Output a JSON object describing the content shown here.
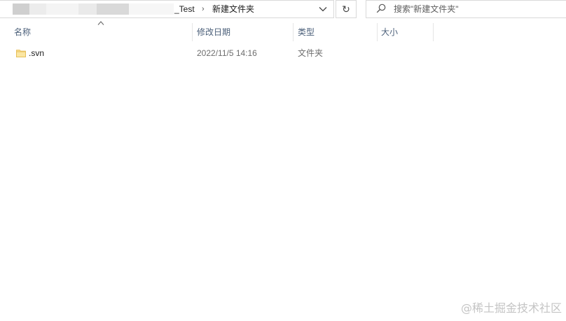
{
  "address_bar": {
    "folder_suffix": "_Test",
    "separator": "›",
    "current_folder": "新建文件夹"
  },
  "refresh": {
    "icon": "refresh-icon",
    "glyph": "↻"
  },
  "search": {
    "placeholder": "搜索\"新建文件夹\"",
    "icon": "search-icon"
  },
  "columns": {
    "name": "名称",
    "date": "修改日期",
    "type": "类型",
    "size": "大小"
  },
  "files": [
    {
      "name": ".svn",
      "modified": "2022/11/5 14:16",
      "type": "文件夹",
      "size": "",
      "icon": "folder-icon"
    }
  ],
  "watermark": "@稀土掘金技术社区",
  "colors": {
    "header_text": "#4c607a",
    "secondary_text": "#6d6d6d",
    "folder_fill": "#f8dc8c"
  }
}
